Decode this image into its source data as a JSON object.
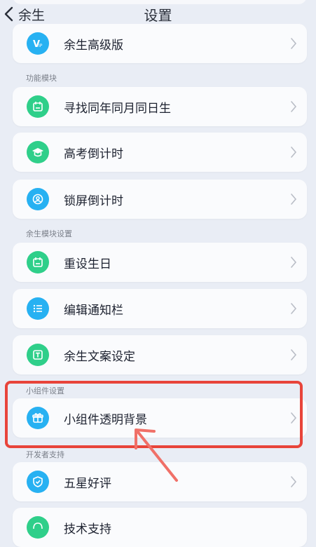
{
  "header": {
    "back_label": "余生",
    "title": "设置"
  },
  "sections": {
    "features": "功能模块",
    "yusheng_settings": "余生模块设置",
    "widget_settings": "小组件设置",
    "developer_support": "开发者支持"
  },
  "items": {
    "premium": "余生高级版",
    "find_same_birthday": "寻找同年同月同日生",
    "gaokao_countdown": "高考倒计时",
    "lockscreen_countdown": "锁屏倒计时",
    "reset_birthday": "重设生日",
    "edit_notification": "编辑通知栏",
    "copywriting": "余生文案设定",
    "widget_transparent": "小组件透明背景",
    "five_star": "五星好评",
    "tech_support": "技术支持"
  },
  "colors": {
    "green": "#2fcf8a",
    "blue": "#27b1f2",
    "highlight": "#e8443a"
  }
}
